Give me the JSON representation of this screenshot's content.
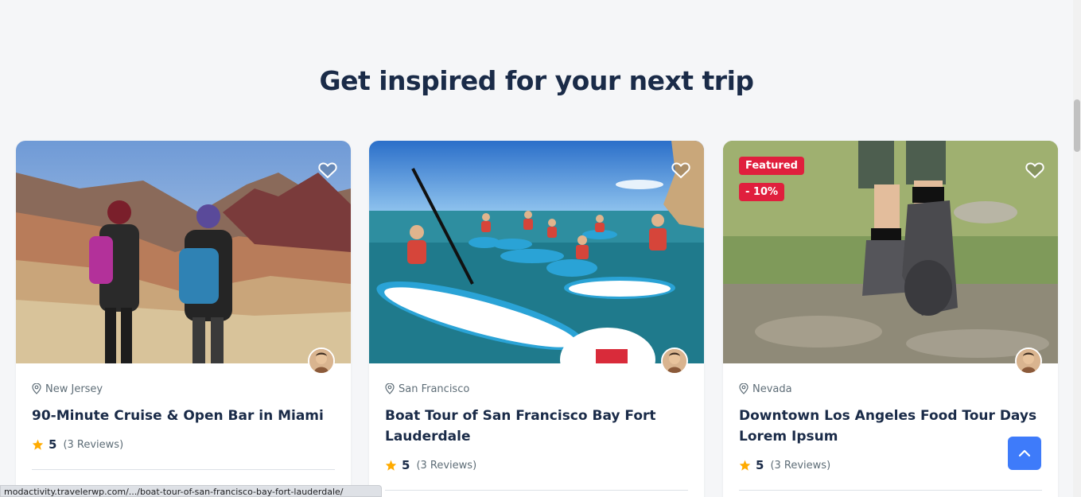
{
  "section": {
    "heading": "Get inspired for your next trip"
  },
  "cards": [
    {
      "location": "New Jersey",
      "title": "90-Minute Cruise & Open Bar in Miami",
      "rating": "5",
      "reviews": "(3 Reviews)"
    },
    {
      "location": "San Francisco",
      "title": "Boat Tour of San Francisco Bay Fort Lauderdale",
      "rating": "5",
      "reviews": "(3 Reviews)"
    },
    {
      "location": "Nevada",
      "title": "Downtown Los Angeles Food Tour Days Lorem Ipsum",
      "rating": "5",
      "reviews": "(3 Reviews)",
      "badge_featured": "Featured",
      "badge_discount": "- 10%"
    }
  ],
  "status_bar": {
    "url": "modactivity.travelerwp.com/.../boat-tour-of-san-francisco-bay-fort-lauderdale/"
  },
  "colors": {
    "heading": "#1a2b48",
    "accent_blue": "#3e7bfa",
    "badge_red": "#e01f3d",
    "star": "#ffab00"
  },
  "icons": {
    "wishlist": "heart-outline-icon",
    "location": "map-pin-icon",
    "rating": "star-icon",
    "back_to_top": "chevron-up-icon"
  }
}
